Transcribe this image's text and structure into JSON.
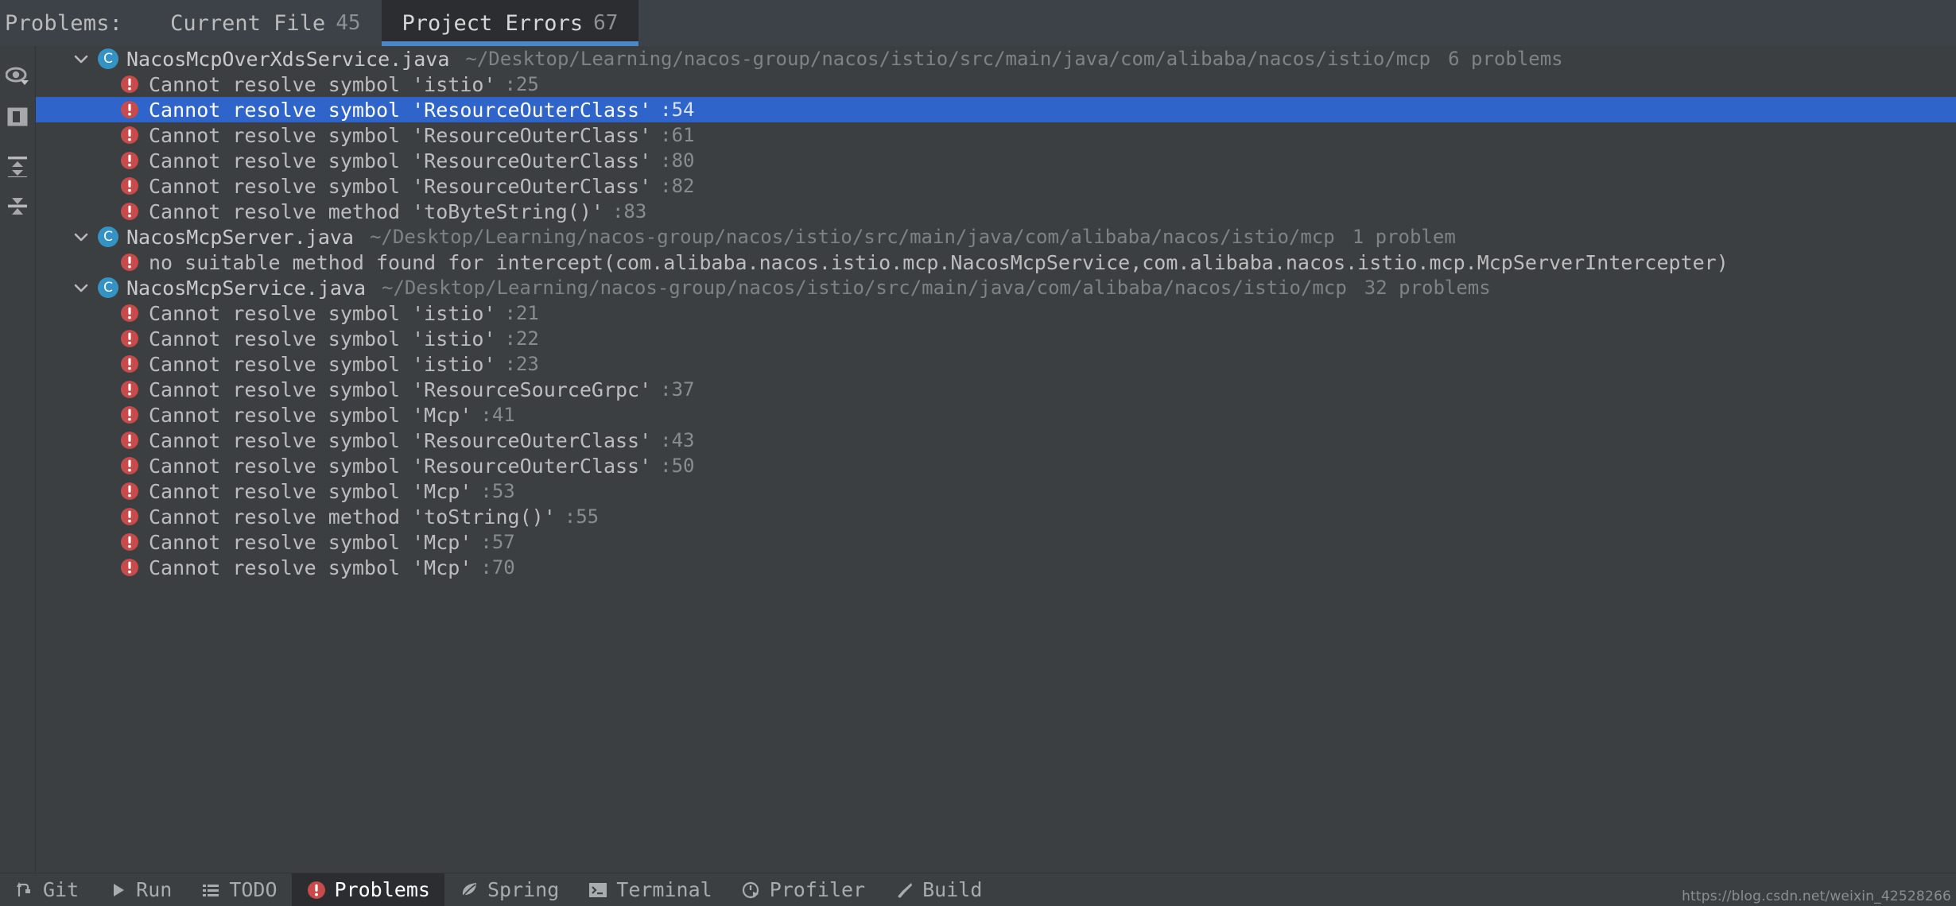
{
  "toolwindow": {
    "title": "Problems:",
    "tabs": [
      {
        "label": "Current File",
        "count": "45",
        "active": false
      },
      {
        "label": "Project Errors",
        "count": "67",
        "active": true
      }
    ]
  },
  "rail": {
    "items": [
      {
        "name": "preview-eye-icon",
        "tooltip": "Preview"
      },
      {
        "name": "open-editor-preview-icon",
        "tooltip": "Open Editor Preview"
      },
      {
        "name": "expand-all-icon",
        "tooltip": "Expand All"
      },
      {
        "name": "collapse-all-icon",
        "tooltip": "Collapse All"
      }
    ]
  },
  "tree": {
    "groups": [
      {
        "filename": "NacosMcpOverXdsService.java",
        "path": "~/Desktop/Learning/nacos-group/nacos/istio/src/main/java/com/alibaba/nacos/istio/mcp",
        "count": "6 problems",
        "expanded": true,
        "problems": [
          {
            "text": "Cannot resolve symbol 'istio'",
            "line": ":25",
            "selected": false
          },
          {
            "text": "Cannot resolve symbol 'ResourceOuterClass'",
            "line": ":54",
            "selected": true
          },
          {
            "text": "Cannot resolve symbol 'ResourceOuterClass'",
            "line": ":61",
            "selected": false
          },
          {
            "text": "Cannot resolve symbol 'ResourceOuterClass'",
            "line": ":80",
            "selected": false
          },
          {
            "text": "Cannot resolve symbol 'ResourceOuterClass'",
            "line": ":82",
            "selected": false
          },
          {
            "text": "Cannot resolve method 'toByteString()'",
            "line": ":83",
            "selected": false
          }
        ]
      },
      {
        "filename": "NacosMcpServer.java",
        "path": "~/Desktop/Learning/nacos-group/nacos/istio/src/main/java/com/alibaba/nacos/istio/mcp",
        "count": "1 problem",
        "expanded": true,
        "problems": [
          {
            "text": "no suitable method found for intercept(com.alibaba.nacos.istio.mcp.NacosMcpService,com.alibaba.nacos.istio.mcp.McpServerIntercepter)",
            "line": "",
            "selected": false
          }
        ]
      },
      {
        "filename": "NacosMcpService.java",
        "path": "~/Desktop/Learning/nacos-group/nacos/istio/src/main/java/com/alibaba/nacos/istio/mcp",
        "count": "32 problems",
        "expanded": true,
        "problems": [
          {
            "text": "Cannot resolve symbol 'istio'",
            "line": ":21",
            "selected": false
          },
          {
            "text": "Cannot resolve symbol 'istio'",
            "line": ":22",
            "selected": false
          },
          {
            "text": "Cannot resolve symbol 'istio'",
            "line": ":23",
            "selected": false
          },
          {
            "text": "Cannot resolve symbol 'ResourceSourceGrpc'",
            "line": ":37",
            "selected": false
          },
          {
            "text": "Cannot resolve symbol 'Mcp'",
            "line": ":41",
            "selected": false
          },
          {
            "text": "Cannot resolve symbol 'ResourceOuterClass'",
            "line": ":43",
            "selected": false
          },
          {
            "text": "Cannot resolve symbol 'ResourceOuterClass'",
            "line": ":50",
            "selected": false
          },
          {
            "text": "Cannot resolve symbol 'Mcp'",
            "line": ":53",
            "selected": false
          },
          {
            "text": "Cannot resolve method 'toString()'",
            "line": ":55",
            "selected": false
          },
          {
            "text": "Cannot resolve symbol 'Mcp'",
            "line": ":57",
            "selected": false
          },
          {
            "text": "Cannot resolve symbol 'Mcp'",
            "line": ":70",
            "selected": false
          }
        ]
      }
    ]
  },
  "statusbar": {
    "items": [
      {
        "label": "Git",
        "icon": "git-branch-icon",
        "active": false
      },
      {
        "label": "Run",
        "icon": "run-play-icon",
        "active": false
      },
      {
        "label": "TODO",
        "icon": "todo-list-icon",
        "active": false
      },
      {
        "label": "Problems",
        "icon": "error-circle-icon",
        "active": true
      },
      {
        "label": "Spring",
        "icon": "spring-leaf-icon",
        "active": false
      },
      {
        "label": "Terminal",
        "icon": "terminal-prompt-icon",
        "active": false
      },
      {
        "label": "Profiler",
        "icon": "profiler-gauge-icon",
        "active": false
      },
      {
        "label": "Build",
        "icon": "build-hammer-icon",
        "active": false
      }
    ],
    "watermark": "https://blog.csdn.net/weixin_42528266"
  },
  "colors": {
    "accent": "#4a88c7",
    "selection": "#2f65ca",
    "error": "#c94a4a",
    "class_icon": "#3592c4",
    "panel_bg": "#3c3f41",
    "tab_bg": "#3c4247",
    "active_tab_bg": "#2b2d30"
  }
}
